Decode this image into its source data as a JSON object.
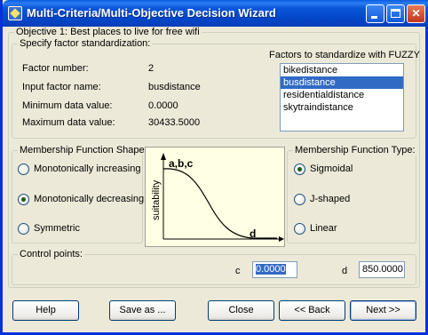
{
  "window": {
    "title": "Multi-Criteria/Multi-Objective Decision Wizard",
    "min_glyph": "",
    "max_glyph": "",
    "close_glyph": "✕"
  },
  "objective": {
    "label": "Objective 1: Best places to live for free wifi"
  },
  "standardization": {
    "label": "Specify factor standardization:",
    "factor_number_label": "Factor number:",
    "factor_number_value": "2",
    "input_factor_label": "Input factor name:",
    "input_factor_value": "busdistance",
    "min_label": "Minimum data value:",
    "min_value": "0.0000",
    "max_label": "Maximum data value:",
    "max_value": "30433.5000",
    "factors_list_label": "Factors to standardize with FUZZY",
    "factors": [
      "bikedistance",
      "busdistance",
      "residentialdistance",
      "skytraindistance"
    ],
    "selected_factor_index": 1
  },
  "shape": {
    "label": "Membership Function Shape:",
    "options": [
      "Monotonically increasing",
      "Monotonically decreasing",
      "Symmetric"
    ],
    "selected": "Monotonically decreasing"
  },
  "graph": {
    "label_abc": "a,b,c",
    "label_d": "d",
    "y_label": "suitability"
  },
  "type": {
    "label": "Membership Function Type:",
    "options": [
      "Sigmoidal",
      "J-shaped",
      "Linear"
    ],
    "selected": "Sigmoidal"
  },
  "control_points": {
    "label": "Control points:",
    "c_label": "c",
    "c_value": "0.0000",
    "d_label": "d",
    "d_value": "850.0000"
  },
  "buttons": {
    "help": "Help",
    "save_as": "Save as ...",
    "close": "Close",
    "back": "<< Back",
    "next": "Next >>"
  },
  "colors": {
    "selection": "#316ac5",
    "titlebar": "#0a57da",
    "graph_bg": "#ffffe3"
  }
}
